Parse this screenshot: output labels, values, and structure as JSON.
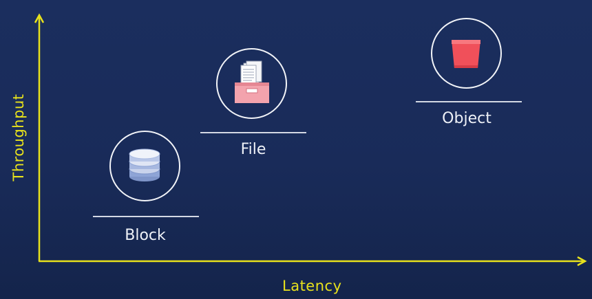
{
  "axes": {
    "x_label": "Latency",
    "y_label": "Throughput",
    "color": "#e8e21c"
  },
  "nodes": {
    "block": {
      "label": "Block",
      "icon": "database-icon"
    },
    "file": {
      "label": "File",
      "icon": "file-box-icon"
    },
    "object": {
      "label": "Object",
      "icon": "bucket-icon"
    }
  },
  "colors": {
    "background": "#1b2e5e",
    "database": "#8ea4d6",
    "file_box": "#f3a3ad",
    "bucket": "#f0505a"
  }
}
